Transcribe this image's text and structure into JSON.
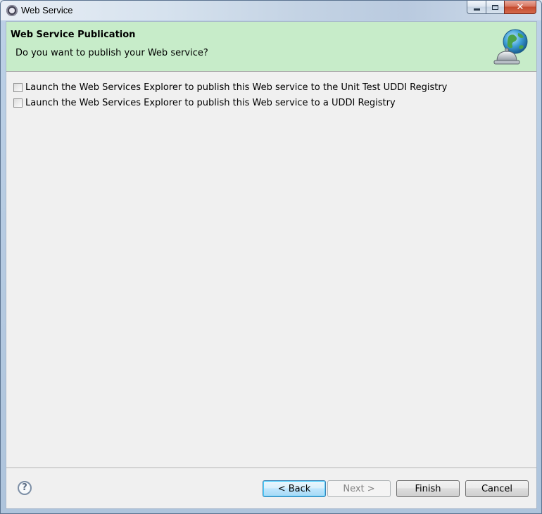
{
  "window": {
    "title": "Web Service"
  },
  "banner": {
    "title": "Web Service Publication",
    "description": "Do you want to publish your Web service?",
    "graphic_icon": "globe-bell-icon"
  },
  "options": [
    {
      "label": "Launch the Web Services Explorer to publish this Web service to the Unit Test UDDI Registry",
      "checked": false
    },
    {
      "label": "Launch the Web Services Explorer to publish this Web service to a UDDI Registry",
      "checked": false
    }
  ],
  "footer": {
    "help_icon": "question-icon",
    "help_glyph": "?",
    "back_label": "< Back",
    "next_label": "Next >",
    "finish_label": "Finish",
    "cancel_label": "Cancel"
  },
  "colors": {
    "banner_bg": "#c7ecc9",
    "client_bg": "#f0f0f0",
    "focused_button_border": "#3c7fb1"
  }
}
